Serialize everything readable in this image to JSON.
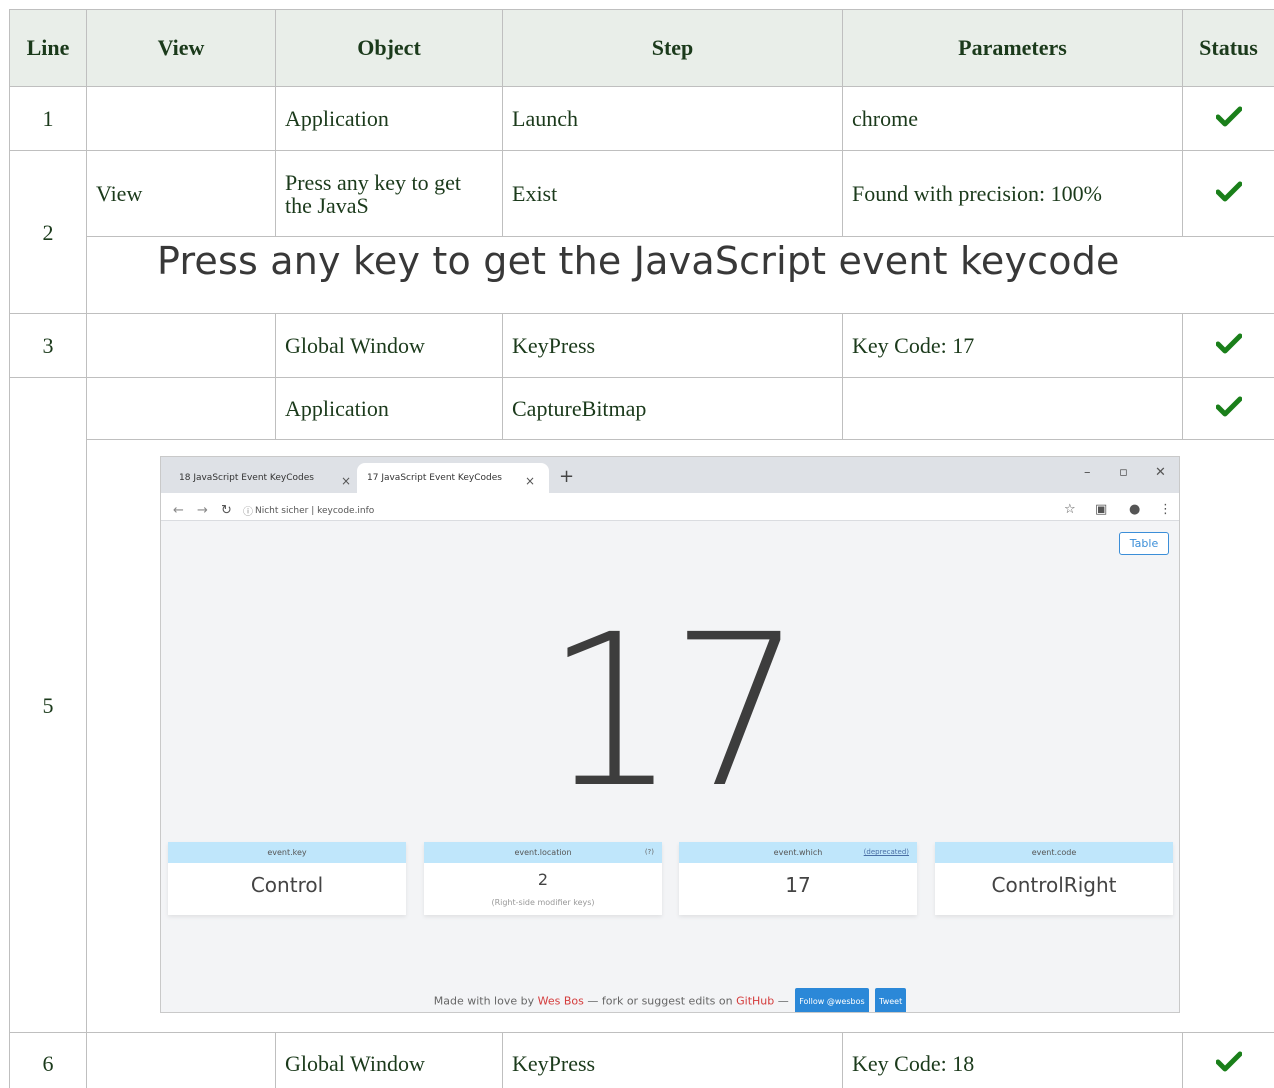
{
  "columns": [
    "Line",
    "View",
    "Object",
    "Step",
    "Parameters",
    "Status"
  ],
  "rows": [
    {
      "line": "1",
      "view": "",
      "object": "Application",
      "step": "Launch",
      "parameters": "chrome",
      "status": "passed"
    },
    {
      "line": "2",
      "view": "View",
      "object": "Press any key to get the JavaS",
      "step": "Exist",
      "parameters": "Found with precision: 100%",
      "status": "passed"
    },
    {
      "line": "3",
      "view": "",
      "object": "Global Window",
      "step": "KeyPress",
      "parameters": "Key Code: 17",
      "status": "passed"
    },
    {
      "line": "5",
      "view": "",
      "object": "Application",
      "step": "CaptureBitmap",
      "parameters": "",
      "status": "passed"
    },
    {
      "line": "6",
      "view": "",
      "object": "Global Window",
      "step": "KeyPress",
      "parameters": "Key Code: 18",
      "status": "passed"
    }
  ],
  "status_icon": "check-icon",
  "colors": {
    "check": "#1a7f1a",
    "header_bg": "#e9eee9",
    "text": "#1b3a1b",
    "accent_blue": "#3b8ed8",
    "card_header": "#bfe6fb"
  },
  "heading_image": {
    "text": "Press any key to get the JavaScript event keycode"
  },
  "screenshot": {
    "tabs": [
      "18  JavaScript Event KeyCodes",
      "17  JavaScript Event KeyCodes"
    ],
    "new_tab": "+",
    "address": "Nicht sicher  |  keycode.info",
    "table_button": "Table",
    "big_number": "17",
    "cards": [
      {
        "title": "event.key",
        "side": "",
        "value": "Control",
        "sub": ""
      },
      {
        "title": "event.location",
        "side": "(?)",
        "value": "2",
        "sub": "(Right-side modifier keys)"
      },
      {
        "title": "event.which",
        "side": "(deprecated)",
        "value": "17",
        "sub": ""
      },
      {
        "title": "event.code",
        "side": "",
        "value": "ControlRight",
        "sub": ""
      }
    ],
    "footer": {
      "prefix": "Made with love by",
      "author": "Wes Bos",
      "middle": "— fork or suggest edits on",
      "repo": "GitHub",
      "dash": "—",
      "follow": "Follow @wesbos",
      "tweet": "Tweet"
    }
  }
}
